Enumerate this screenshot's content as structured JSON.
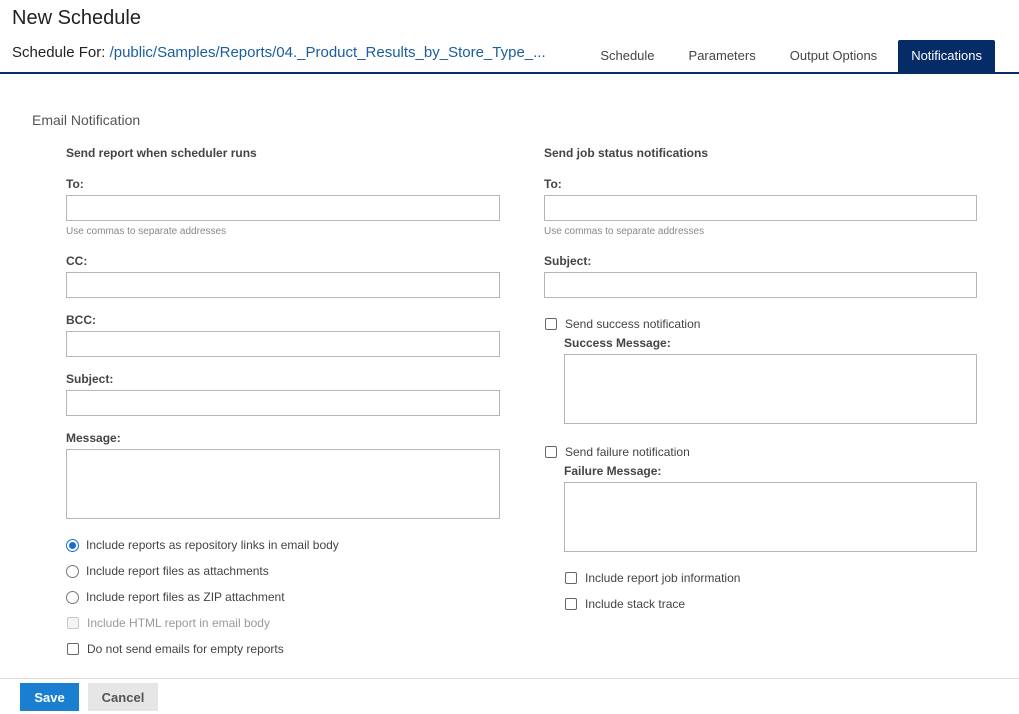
{
  "header": {
    "title": "New Schedule",
    "schedule_for_label": "Schedule For:",
    "schedule_for_path": "/public/Samples/Reports/04._Product_Results_by_Store_Type_..."
  },
  "tabs": [
    {
      "label": "Schedule",
      "active": false
    },
    {
      "label": "Parameters",
      "active": false
    },
    {
      "label": "Output Options",
      "active": false
    },
    {
      "label": "Notifications",
      "active": true
    }
  ],
  "section_title": "Email Notification",
  "left": {
    "heading": "Send report when scheduler runs",
    "to_label": "To:",
    "to_value": "",
    "to_hint": "Use commas to separate addresses",
    "cc_label": "CC:",
    "cc_value": "",
    "bcc_label": "BCC:",
    "bcc_value": "",
    "subject_label": "Subject:",
    "subject_value": "",
    "message_label": "Message:",
    "message_value": "",
    "options": [
      {
        "label": "Include reports as repository links in email body",
        "type": "radio",
        "checked": true
      },
      {
        "label": "Include report files as attachments",
        "type": "radio",
        "checked": false
      },
      {
        "label": "Include report files as ZIP attachment",
        "type": "radio",
        "checked": false
      },
      {
        "label": "Include HTML report in email body",
        "type": "checkbox",
        "checked": false,
        "disabled": true
      },
      {
        "label": "Do not send emails for empty reports",
        "type": "checkbox",
        "checked": false
      }
    ]
  },
  "right": {
    "heading": "Send job status notifications",
    "to_label": "To:",
    "to_value": "",
    "to_hint": "Use commas to separate addresses",
    "subject_label": "Subject:",
    "subject_value": "",
    "success_checkbox": "Send success notification",
    "success_message_label": "Success Message:",
    "success_message_value": "",
    "failure_checkbox": "Send failure notification",
    "failure_message_label": "Failure Message:",
    "failure_message_value": "",
    "include_job_info": "Include report job information",
    "include_stack_trace": "Include stack trace"
  },
  "footer": {
    "save_label": "Save",
    "cancel_label": "Cancel"
  },
  "colors": {
    "accent": "#062c68",
    "primary_button": "#1b7fd1",
    "link": "#1a5e9f"
  }
}
